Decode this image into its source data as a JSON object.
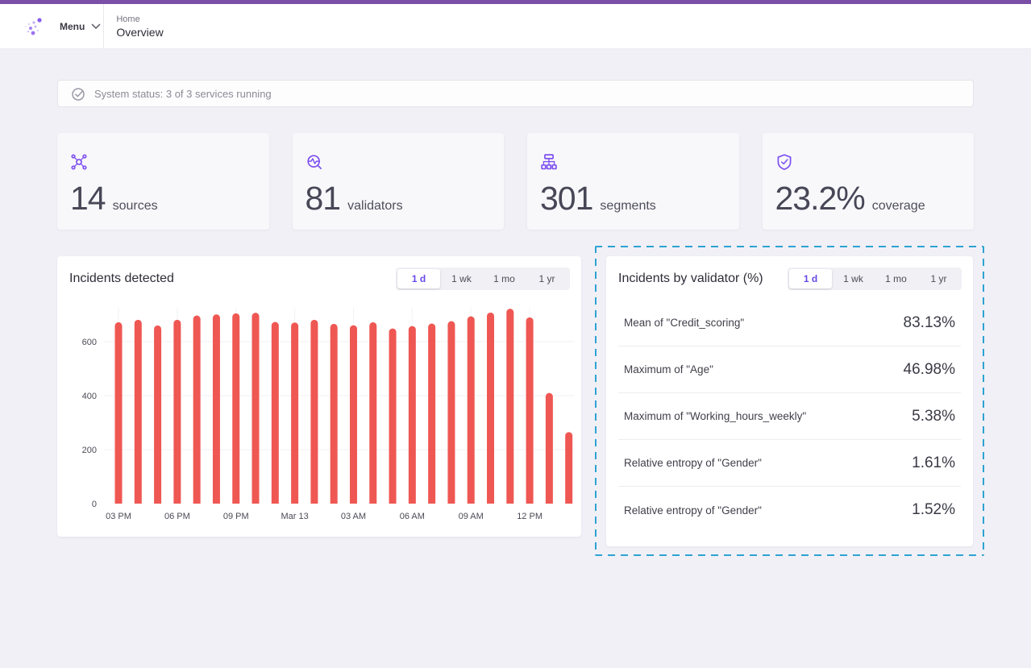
{
  "topbar": {
    "menu_label": "Menu",
    "breadcrumb": {
      "section": "Home",
      "page": "Overview"
    }
  },
  "status": {
    "text": "System status: 3 of 3 services running"
  },
  "stats": [
    {
      "icon": "sources-network-icon",
      "value": "14",
      "label": "sources"
    },
    {
      "icon": "validators-scan-icon",
      "value": "81",
      "label": "validators"
    },
    {
      "icon": "segments-sitemap-icon",
      "value": "301",
      "label": "segments"
    },
    {
      "icon": "coverage-shield-icon",
      "value": "23.2%",
      "label": "coverage"
    }
  ],
  "time_ranges": {
    "options": [
      "1 d",
      "1 wk",
      "1 mo",
      "1 yr"
    ],
    "selected": "1 d",
    "selected_index": 0
  },
  "incidents_panel": {
    "title": "Incidents detected"
  },
  "chart_data": {
    "type": "bar",
    "title": "Incidents detected",
    "x_tick_labels": [
      "03 PM",
      "06 PM",
      "09 PM",
      "Mar 13",
      "03 AM",
      "06 AM",
      "09 AM",
      "12 PM"
    ],
    "tick_every": 3,
    "values": [
      672,
      681,
      660,
      681,
      697,
      701,
      705,
      707,
      673,
      671,
      681,
      666,
      661,
      672,
      649,
      658,
      667,
      676,
      694,
      708,
      722,
      690,
      410,
      265
    ],
    "ylabel": "",
    "xlabel": "",
    "ylim": [
      0,
      760
    ],
    "y_ticks": [
      0,
      200,
      400,
      600
    ],
    "bar_color": "#ef5753",
    "grid": true
  },
  "validator_panel": {
    "title": "Incidents by validator (%)",
    "rows": [
      {
        "label": "Mean of \"Credit_scoring\"",
        "value": "83.13%"
      },
      {
        "label": "Maximum of \"Age\"",
        "value": "46.98%"
      },
      {
        "label": "Maximum of \"Working_hours_weekly\"",
        "value": "5.38%"
      },
      {
        "label": "Relative entropy of \"Gender\"",
        "value": "1.61%"
      },
      {
        "label": "Relative entropy of \"Gender\"",
        "value": "1.52%"
      }
    ]
  },
  "colors": {
    "accent_purple": "#7b4ea7",
    "icon_purple": "#7d4ff0",
    "bar_red": "#ef5753",
    "dashed_teal": "#2da3d2",
    "tab_selected_text": "#6847e8"
  }
}
